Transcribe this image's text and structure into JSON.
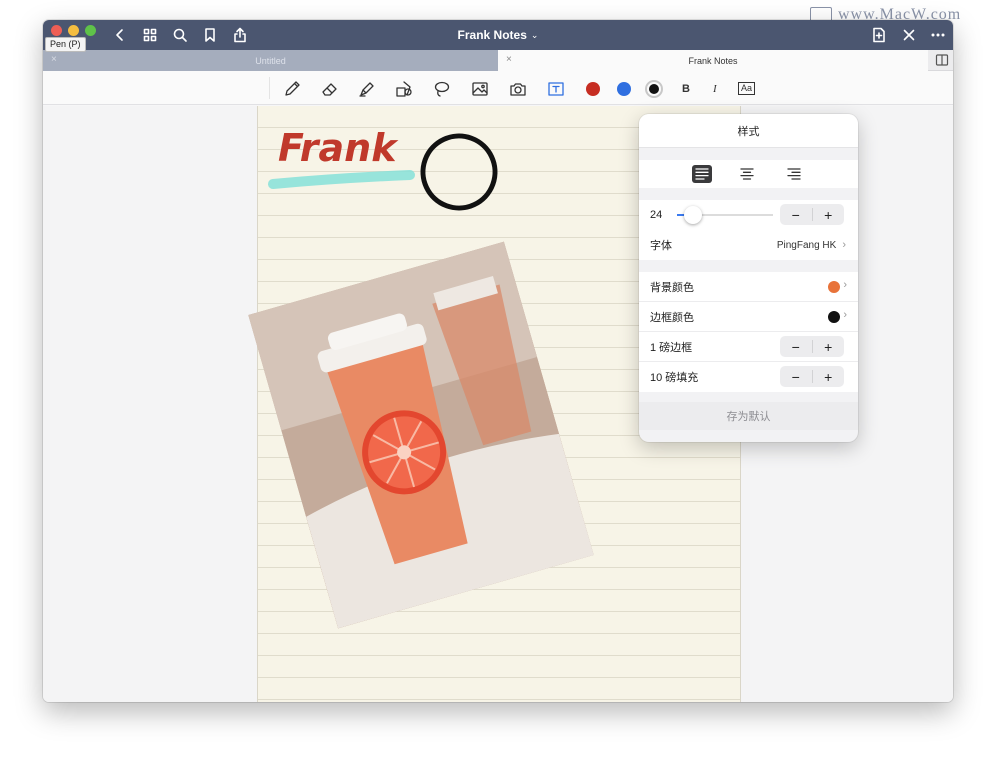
{
  "watermark": "www.MacW.com",
  "window": {
    "title": "Frank Notes",
    "tooltip": "Pen (P)"
  },
  "tabs": [
    {
      "label": "Untitled",
      "active": false
    },
    {
      "label": "Frank Notes",
      "active": true
    }
  ],
  "toolbar": {
    "tools": [
      "pen-icon",
      "eraser-icon",
      "highlighter-icon",
      "shapes-icon",
      "lasso-icon",
      "image-icon",
      "camera-icon",
      "textbox-icon"
    ],
    "colors": [
      "#c62d22",
      "#2f6fe0",
      "#111111"
    ],
    "bold_label": "B",
    "italic_label": "I",
    "text_style_label": "Aa"
  },
  "note": {
    "handwriting": "Frank",
    "ink_color": "#c0392b",
    "highlight_color": "#86e0d8"
  },
  "style_popover": {
    "title": "样式",
    "alignment": [
      "left",
      "center",
      "right"
    ],
    "selected_alignment": "left",
    "font_size": "24",
    "font_size_slider_fraction": 0.2,
    "font_label": "字体",
    "font_value": "PingFang HK",
    "bg_color_label": "背景颜色",
    "bg_color": "#e8733a",
    "border_color_label": "边框颜色",
    "border_color": "#111111",
    "border_label": "1 磅边框",
    "padding_label": "10 磅填充",
    "save_default_label": "存为默认",
    "minus": "−",
    "plus": "+"
  }
}
